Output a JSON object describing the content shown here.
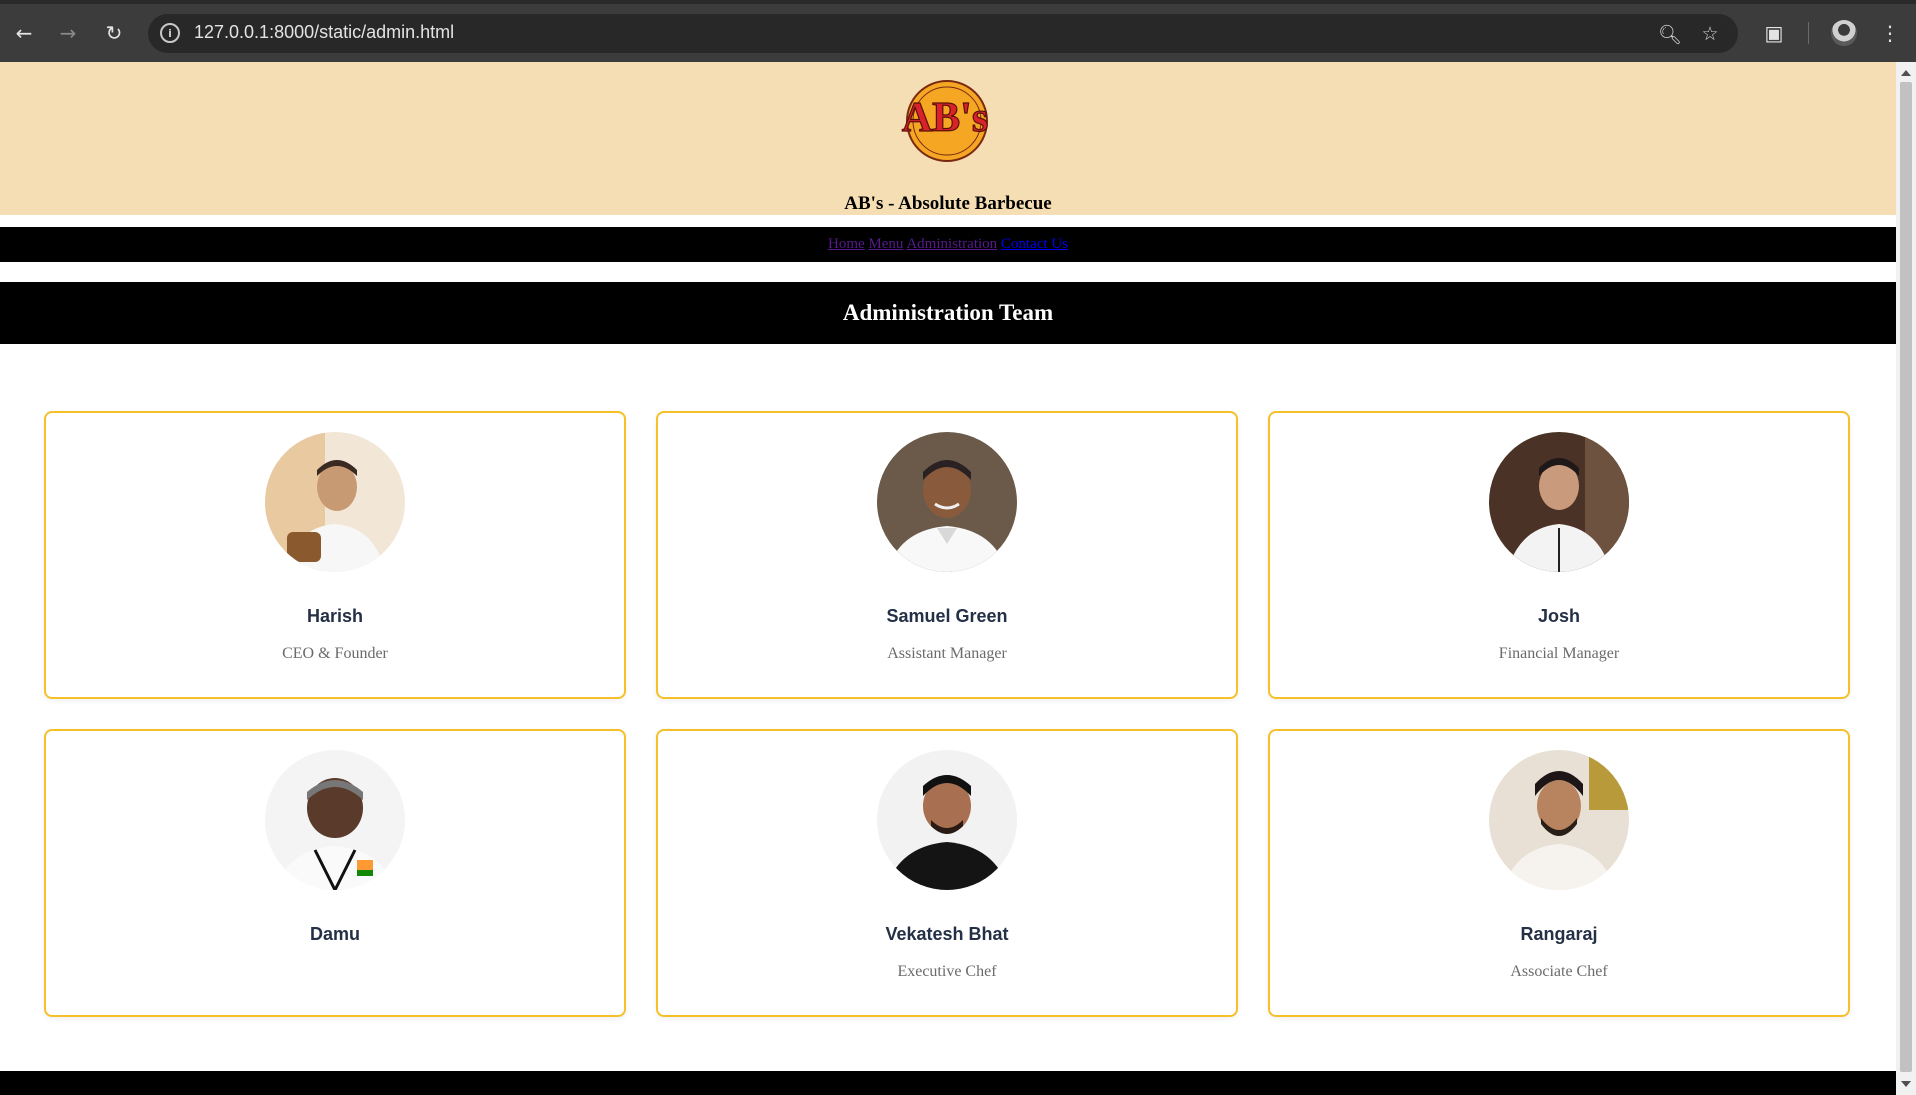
{
  "browser": {
    "url": "127.0.0.1:8000/static/admin.html",
    "icons": [
      "back-icon",
      "forward-icon",
      "reload-icon",
      "site-info-icon",
      "zoom-icon",
      "bookmark-star-icon",
      "screenshot-icon",
      "profile-icon",
      "kebab-menu-icon"
    ]
  },
  "site": {
    "logo_text": "AB's",
    "title": "AB's - Absolute Barbecue",
    "nav": [
      {
        "label": "Home"
      },
      {
        "label": "Menu"
      },
      {
        "label": "Administration"
      },
      {
        "label": "Contact Us"
      }
    ],
    "section_title": "Administration Team"
  },
  "team": [
    {
      "name": "Harish",
      "role": "CEO & Founder"
    },
    {
      "name": "Samuel Green",
      "role": "Assistant Manager"
    },
    {
      "name": "Josh",
      "role": "Financial Manager"
    },
    {
      "name": "Damu",
      "role": ""
    },
    {
      "name": "Vekatesh Bhat",
      "role": "Executive Chef"
    },
    {
      "name": "Rangaraj",
      "role": "Associate Chef"
    }
  ],
  "colors": {
    "header_bg": "#f5deb3",
    "card_border": "#f5c02a",
    "nav_bg": "#000000",
    "name_text": "#233046",
    "role_text": "#6b6b6b"
  }
}
